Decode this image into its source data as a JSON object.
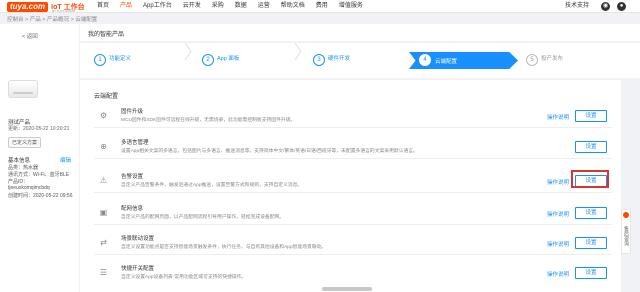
{
  "topnav": {
    "logo_badge": "tuya.com",
    "logo_text": "IoT 工作台",
    "logo_sub": "BY TUYA SMART",
    "items": [
      "首页",
      "产品",
      "App工作台",
      "云开发",
      "采购",
      "数据",
      "运营",
      "帮助文档",
      "费用",
      "增值服务"
    ],
    "active_index": 1,
    "tech_support": "技术支持"
  },
  "breadcrumb": "控制台 > 产品 > 产品概况 > 云端配置",
  "left": {
    "back": "< 返回",
    "product_name": "测试产品",
    "update_time": "更新：2020-05-22 10:20:21",
    "status_button": "已定义方案",
    "basic_info_title": "基本信息",
    "edit": "编辑",
    "info": [
      "品类：热水器",
      "通讯方式：Wi-Fi、蓝牙BLE",
      "产品ID：",
      "tjeeuxkomqimcbdq",
      "创建时间：2020-05-22 09:56"
    ]
  },
  "main": {
    "title": "我的智能产品",
    "steps": [
      {
        "num": "1",
        "label": "功能定义"
      },
      {
        "num": "2",
        "label": "App 面板"
      },
      {
        "num": "3",
        "label": "硬件开发"
      },
      {
        "num": "4",
        "label": "云端配置"
      },
      {
        "num": "5",
        "label": "投产发布"
      }
    ],
    "active_step": 3,
    "content_title": "云端配置",
    "rows": [
      {
        "icon": "⚙",
        "icon_name": "firmware-icon",
        "title": "固件升级",
        "desc": "MCU固件和SDK固件可远程在线升级，无需烧录，此功能需控制板支持固件升级。",
        "doc": "操作说明",
        "btn": "设置"
      },
      {
        "icon": "⊕",
        "icon_name": "multilingual-icon",
        "title": "多语言管理",
        "desc": "设置App相关文案的多语言，包括图片与多语言、推送消息等，支持简体中文/繁体/英语/日语/西班牙等，未配置多语言的文案采用默认语言。",
        "doc": "",
        "btn": "设置"
      },
      {
        "icon": "⚠",
        "icon_name": "alarm-icon",
        "title": "告警设置",
        "desc": "自定义产品告警条件，触发后通过App推送，设置告警方式和规则，支持自定义消息。",
        "doc": "操作说明",
        "btn": "设置"
      },
      {
        "icon": "▣",
        "icon_name": "network-guide-icon",
        "title": "配网信息",
        "desc": "自定义产品的配网页面，以产品配网流程引导用户操作，轻松完成设备配网。",
        "doc": "操作说明",
        "btn": "设置"
      },
      {
        "icon": "⇄",
        "icon_name": "scene-linkage-icon",
        "title": "场景联动设置",
        "desc": "自定义设置功能点是否支持智能场景触发条件，执行任务，与自有其他设备和App智能场景联动。",
        "doc": "操作说明",
        "btn": "设置"
      },
      {
        "icon": "☰",
        "icon_name": "shortcut-icon",
        "title": "快捷开关配置",
        "desc": "自定义设置App设备列表·常用功能区域可支持的快捷操作。",
        "doc": "操作说明",
        "btn": "设置"
      }
    ]
  },
  "float_tab": "售后咨询"
}
